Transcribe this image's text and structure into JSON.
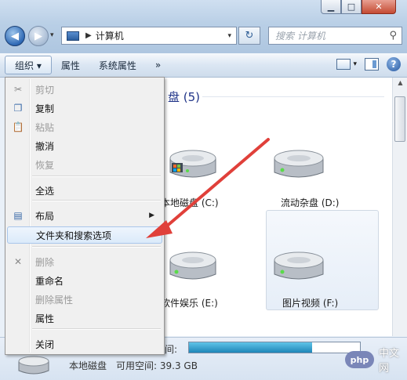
{
  "window": {
    "controls": {
      "minimize": "▁",
      "maximize": "□",
      "close": "✕"
    }
  },
  "address": {
    "path": "计算机"
  },
  "search": {
    "placeholder": "搜索 计算机"
  },
  "toolbar": {
    "organize": "组织 ▾",
    "properties": "属性",
    "system_properties": "系统属性",
    "more": "»"
  },
  "content": {
    "group_header": "盘 (5)",
    "drives": [
      {
        "label": "本地磁盘 (C:)"
      },
      {
        "label": "流动杂盘 (D:)"
      },
      {
        "label": "软件娱乐 (E:)"
      },
      {
        "label": "图片视频 (F:)"
      }
    ]
  },
  "status": {
    "drive_name": "本地磁盘",
    "total_label": "间:",
    "free_label": "可用空间: 39.3 GB",
    "used_fraction": 0.72
  },
  "menu": {
    "items": [
      {
        "label": "剪切",
        "icon": "scissors-icon",
        "disabled": true
      },
      {
        "label": "复制",
        "icon": "copy-icon",
        "disabled": false
      },
      {
        "label": "粘贴",
        "icon": "paste-icon",
        "disabled": true
      },
      {
        "label": "撤消",
        "disabled": false
      },
      {
        "label": "恢复",
        "disabled": true
      },
      {
        "label": "全选",
        "disabled": false
      },
      {
        "label": "布局",
        "icon": "layout-icon",
        "disabled": false,
        "submenu": true
      },
      {
        "label": "文件夹和搜索选项",
        "disabled": false,
        "highlighted": true
      },
      {
        "label": "删除",
        "icon": "delete-icon",
        "disabled": true
      },
      {
        "label": "重命名",
        "disabled": false
      },
      {
        "label": "删除属性",
        "disabled": true
      },
      {
        "label": "属性",
        "disabled": false
      },
      {
        "label": "关闭",
        "disabled": false
      }
    ]
  },
  "watermark": {
    "badge": "php",
    "text": "中文网"
  },
  "colors": {
    "accent_arrow": "#e0403a",
    "status_fill": "#2a94c4"
  }
}
